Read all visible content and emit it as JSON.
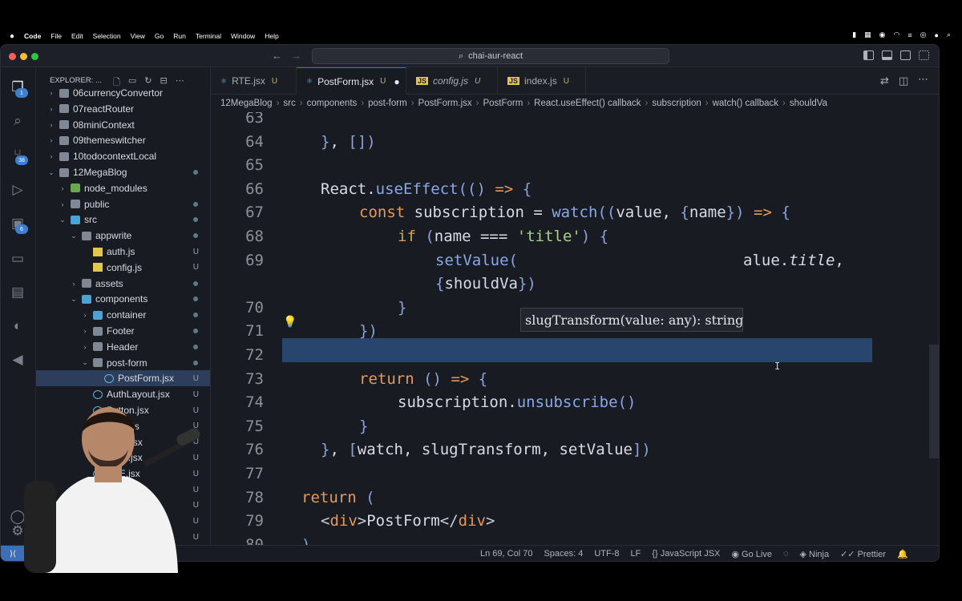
{
  "mac_menu": {
    "app": "Code",
    "items": [
      "File",
      "Edit",
      "Selection",
      "View",
      "Go",
      "Run",
      "Terminal",
      "Window",
      "Help"
    ]
  },
  "window": {
    "search_text": "chai-aur-react"
  },
  "activity_badges": {
    "explorer": "1",
    "scm": "38",
    "extensions": "6"
  },
  "explorer": {
    "title": "EXPLORER: ...",
    "rows": [
      {
        "label": "06currencyConvertor",
        "indent": 0,
        "type": "folder",
        "open": false,
        "status": ""
      },
      {
        "label": "07reactRouter",
        "indent": 0,
        "type": "folder",
        "open": false,
        "status": ""
      },
      {
        "label": "08miniContext",
        "indent": 0,
        "type": "folder",
        "open": false,
        "status": ""
      },
      {
        "label": "09themeswitcher",
        "indent": 0,
        "type": "folder",
        "open": false,
        "status": ""
      },
      {
        "label": "10todocontextLocal",
        "indent": 0,
        "type": "folder",
        "open": false,
        "status": ""
      },
      {
        "label": "12MegaBlog",
        "indent": 0,
        "type": "folder",
        "open": true,
        "status": "dot"
      },
      {
        "label": "node_modules",
        "indent": 1,
        "type": "folder",
        "open": false,
        "status": ""
      },
      {
        "label": "public",
        "indent": 1,
        "type": "folder",
        "open": false,
        "status": "dot"
      },
      {
        "label": "src",
        "indent": 1,
        "type": "folder",
        "open": true,
        "status": "dot"
      },
      {
        "label": "appwrite",
        "indent": 2,
        "type": "folder",
        "open": true,
        "status": "dot"
      },
      {
        "label": "auth.js",
        "indent": 3,
        "type": "js",
        "open": false,
        "status": "U"
      },
      {
        "label": "config.js",
        "indent": 3,
        "type": "js",
        "open": false,
        "status": "U"
      },
      {
        "label": "assets",
        "indent": 2,
        "type": "folder",
        "open": false,
        "status": "dot"
      },
      {
        "label": "components",
        "indent": 2,
        "type": "folder",
        "open": true,
        "status": "dot"
      },
      {
        "label": "container",
        "indent": 3,
        "type": "folder",
        "open": false,
        "status": "dot"
      },
      {
        "label": "Footer",
        "indent": 3,
        "type": "folder",
        "open": false,
        "status": "dot"
      },
      {
        "label": "Header",
        "indent": 3,
        "type": "folder",
        "open": false,
        "status": "dot"
      },
      {
        "label": "post-form",
        "indent": 3,
        "type": "folder",
        "open": true,
        "status": "dot"
      },
      {
        "label": "PostForm.jsx",
        "indent": 4,
        "type": "jsx",
        "open": false,
        "status": "U",
        "selected": true
      },
      {
        "label": "AuthLayout.jsx",
        "indent": 3,
        "type": "jsx",
        "open": false,
        "status": "U"
      },
      {
        "label": "Button.jsx",
        "indent": 3,
        "type": "jsx",
        "open": false,
        "status": "U"
      },
      {
        "label": "index.js",
        "indent": 3,
        "type": "js",
        "open": false,
        "status": "U"
      },
      {
        "label": "Input.jsx",
        "indent": 3,
        "type": "jsx",
        "open": false,
        "status": "U"
      },
      {
        "label": "Logo.jsx",
        "indent": 3,
        "type": "jsx",
        "open": false,
        "status": "U"
      },
      {
        "label": "RTE.jsx",
        "indent": 3,
        "type": "jsx",
        "open": false,
        "status": "U"
      },
      {
        "label": "Select.jsx",
        "indent": 3,
        "type": "jsx",
        "open": false,
        "status": "U"
      },
      {
        "label": "",
        "indent": 3,
        "type": "jsx",
        "open": false,
        "status": "U"
      },
      {
        "label": "",
        "indent": 3,
        "type": "jsx",
        "open": false,
        "status": "U"
      },
      {
        "label": "",
        "indent": 3,
        "type": "jsx",
        "open": false,
        "status": "U"
      }
    ]
  },
  "tabs": [
    {
      "label": "RTE.jsx",
      "icon": "react",
      "status": "U",
      "active": false
    },
    {
      "label": "PostForm.jsx",
      "icon": "react",
      "status": "●",
      "active": true
    },
    {
      "label": "config.js",
      "icon": "js",
      "status": "U",
      "active": false
    },
    {
      "label": "index.js",
      "icon": "js",
      "status": "U",
      "active": false
    }
  ],
  "breadcrumbs": [
    "12MegaBlog",
    "src",
    "components",
    "post-form",
    "PostForm.jsx",
    "PostForm",
    "React.useEffect() callback",
    "subscription",
    "watch() callback",
    "shouldVa"
  ],
  "line_numbers": [
    "63",
    "64",
    "65",
    "66",
    "67",
    "68",
    "69",
    "",
    "70",
    "71",
    "72",
    "73",
    "74",
    "75",
    "76",
    "77",
    "78",
    "79",
    "80"
  ],
  "code_lines": [
    "",
    "}, [])",
    "",
    "React.useEffect(() => {",
    "const subscription = watch((value, {name}) => {",
    "if (name === 'title') {",
    "setValue(",
    "{shouldVa})",
    "}",
    "})",
    "",
    "return () => {",
    "subscription.unsubscribe()",
    "}",
    "}, [watch, slugTransform, setValue])",
    "",
    "return (",
    "<div>PostForm</div>",
    ")"
  ],
  "hover_signature": "slugTransform(value: any): string",
  "hidden_suffix": "alue.title,",
  "status_bar": {
    "position": "Ln 69, Col 70",
    "spaces": "Spaces: 4",
    "encoding": "UTF-8",
    "eol": "LF",
    "language": "{} JavaScript JSX",
    "golive": "Go Live",
    "ninja": "Ninja",
    "prettier": "Prettier"
  }
}
